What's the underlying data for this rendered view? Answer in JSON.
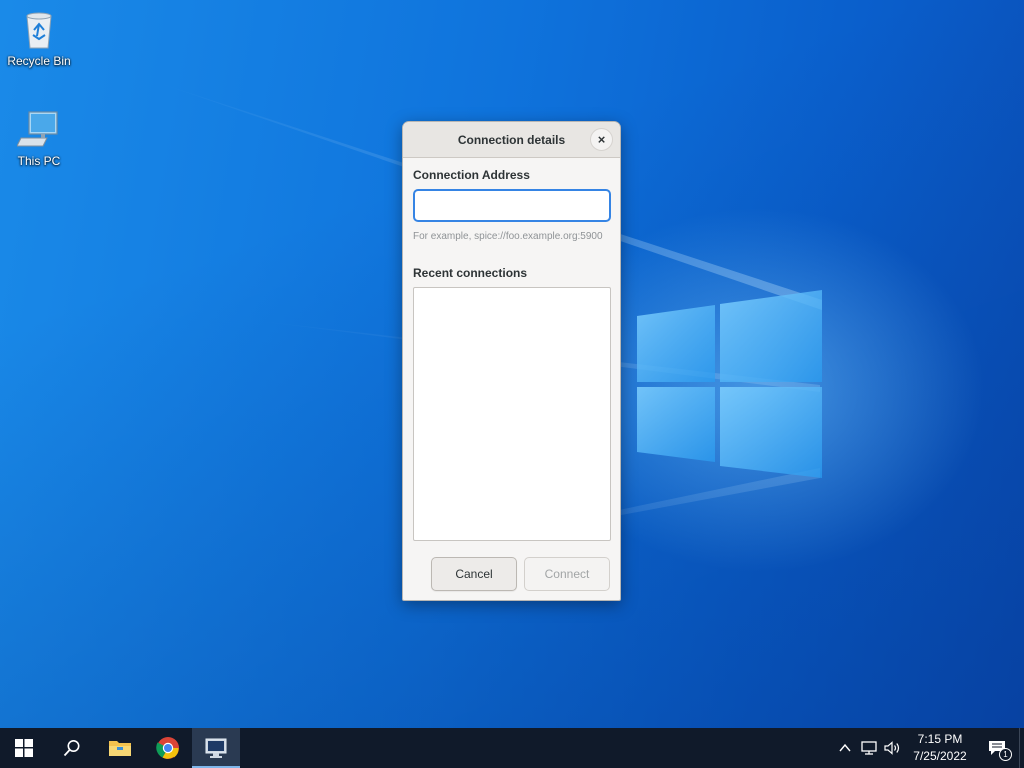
{
  "desktop": {
    "icons": [
      {
        "label": "Recycle Bin",
        "icon": "recycle-bin-icon"
      },
      {
        "label": "This PC",
        "icon": "computer-icon"
      }
    ]
  },
  "dialog": {
    "title": "Connection details",
    "close_label": "×",
    "address_label": "Connection Address",
    "address_value": "",
    "address_hint": "For example, spice://foo.example.org:5900",
    "recent_label": "Recent connections",
    "recent_items": [],
    "cancel_label": "Cancel",
    "connect_label": "Connect"
  },
  "taskbar": {
    "buttons": [
      {
        "name": "start",
        "icon": "windows-logo-icon"
      },
      {
        "name": "search",
        "icon": "search-icon"
      },
      {
        "name": "file-explorer",
        "icon": "folder-icon"
      },
      {
        "name": "chrome",
        "icon": "chrome-icon"
      },
      {
        "name": "remote-viewer",
        "icon": "monitor-icon",
        "active": true
      }
    ],
    "tray": {
      "icons": [
        "chevron-up-icon",
        "network-icon",
        "volume-icon"
      ],
      "time": "7:15 PM",
      "date": "7/25/2022",
      "notification_count": "1"
    }
  },
  "colors": {
    "accent": "#3584e4",
    "taskbar": "#101a2a",
    "wallpaper": "#0f73dc"
  }
}
